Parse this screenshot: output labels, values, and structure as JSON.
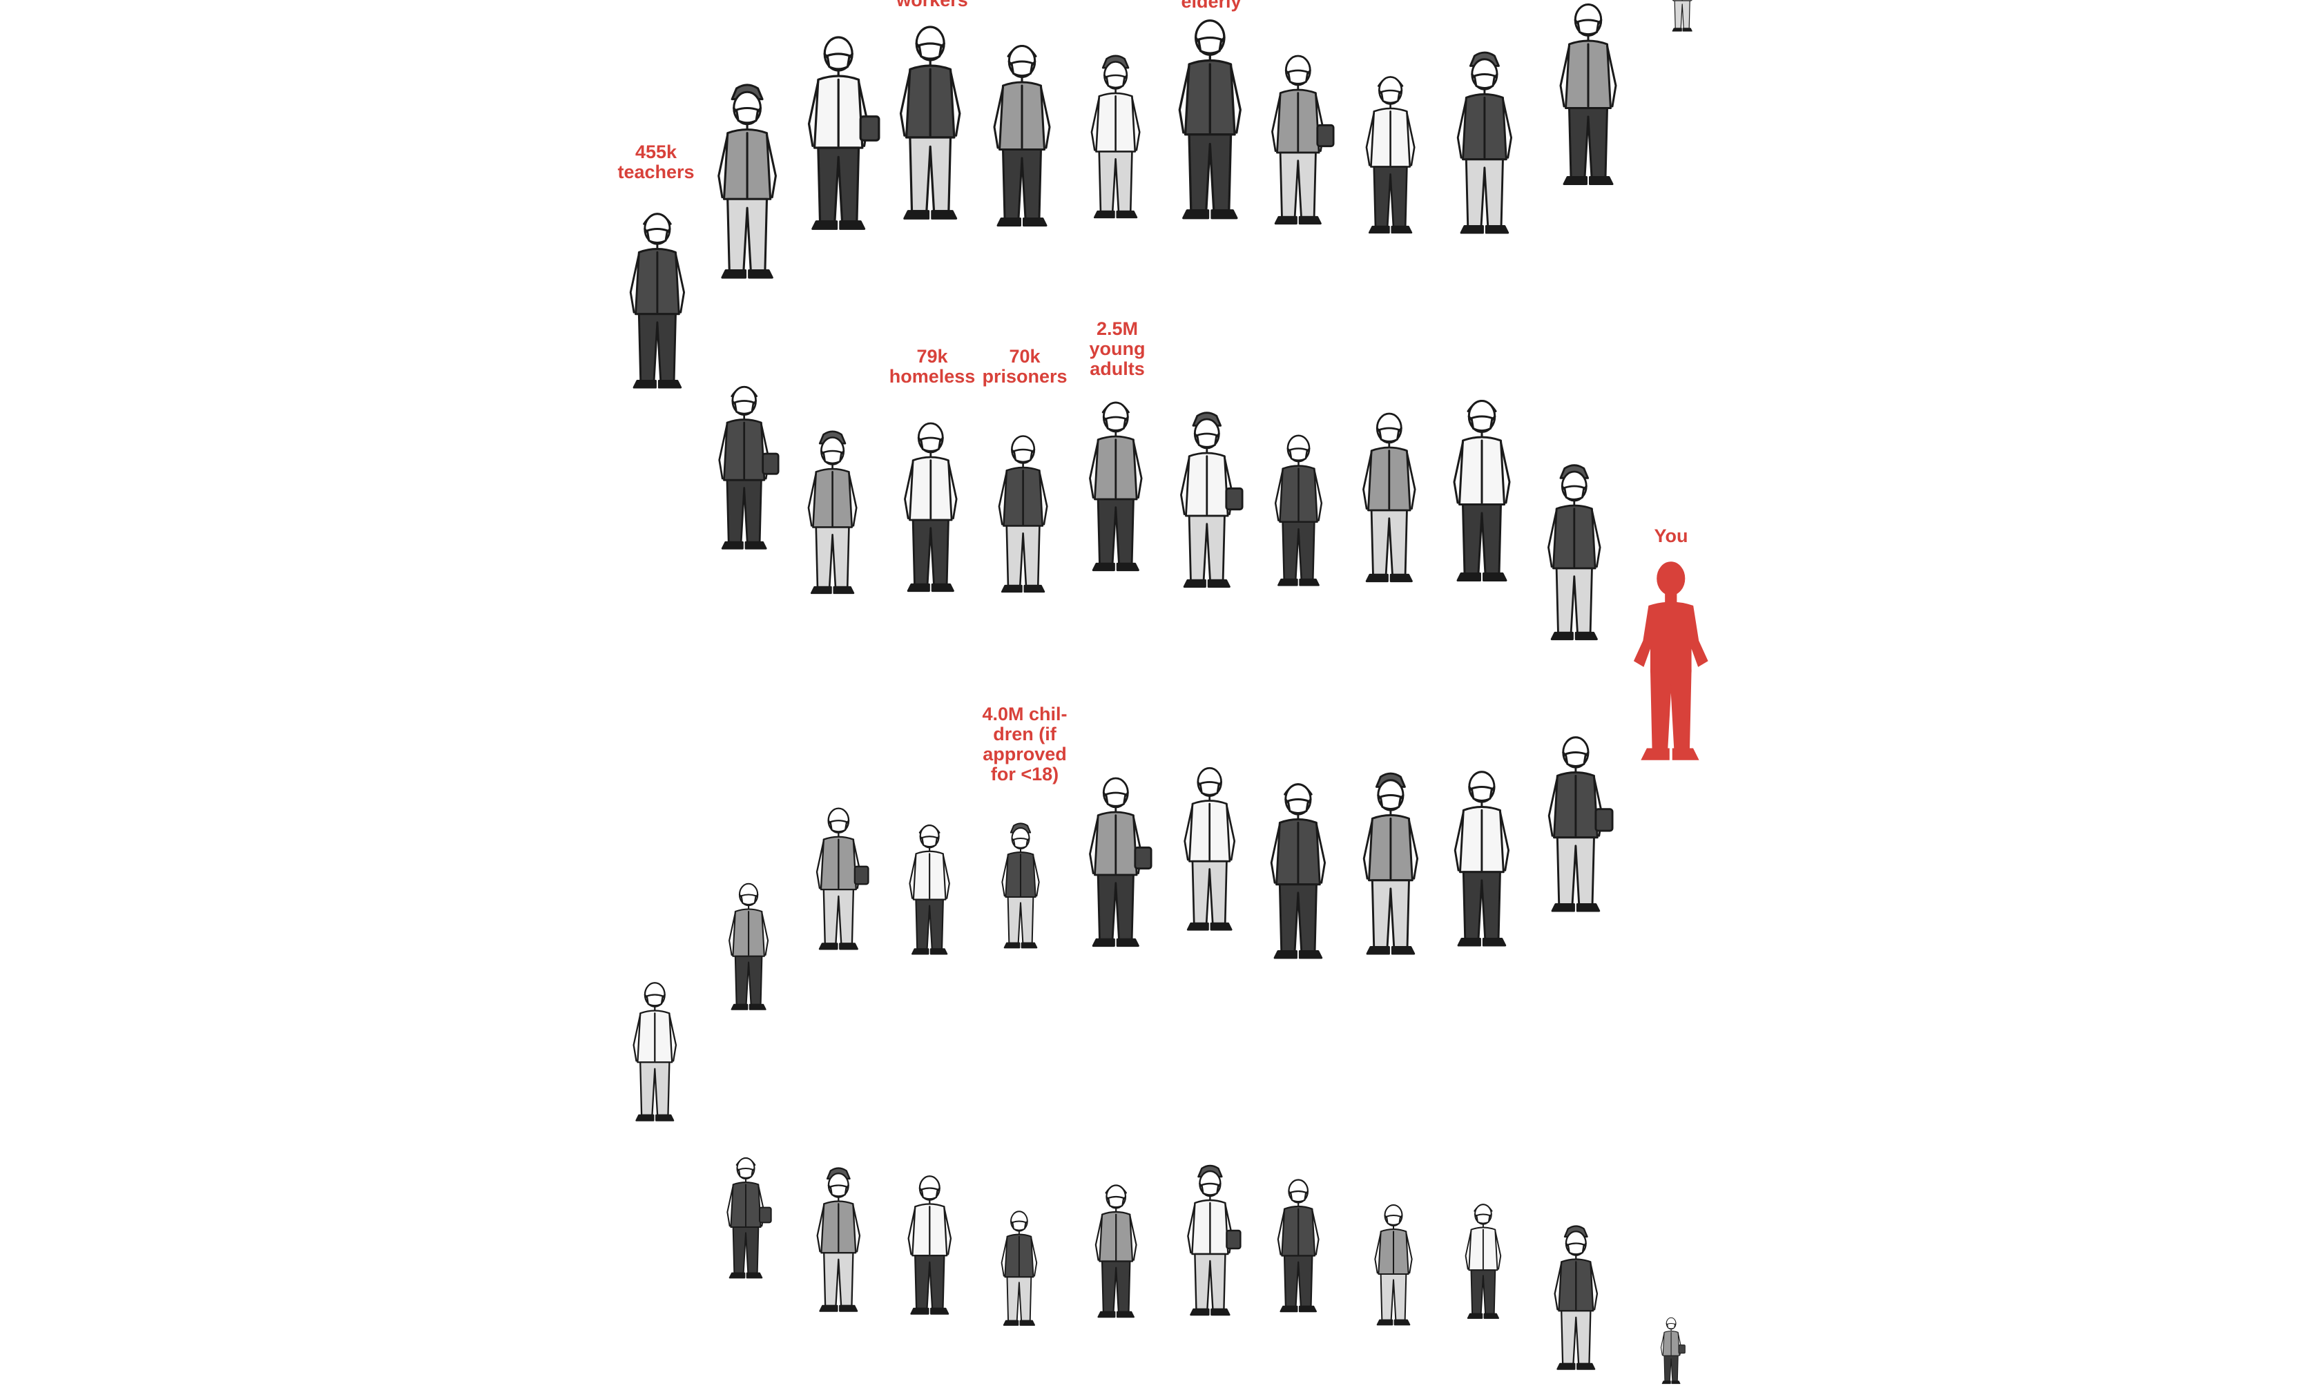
{
  "accent_color": "#d8413a",
  "ink_color": "#1a1a1a",
  "labels": {
    "workers": "workers",
    "elderly": "elderly",
    "teachers": [
      "455k",
      "teachers"
    ],
    "homeless": [
      "79k",
      "homeless"
    ],
    "prisoners": [
      "70k",
      "prisoners"
    ],
    "young_adults": [
      "2.5M",
      "young",
      "adults"
    ],
    "you": "You",
    "children": [
      "4.0M chil-",
      "dren (if",
      "approved",
      "for <18)"
    ]
  },
  "figure_icon": "masked-person-illustration",
  "you_icon": "you-silhouette"
}
